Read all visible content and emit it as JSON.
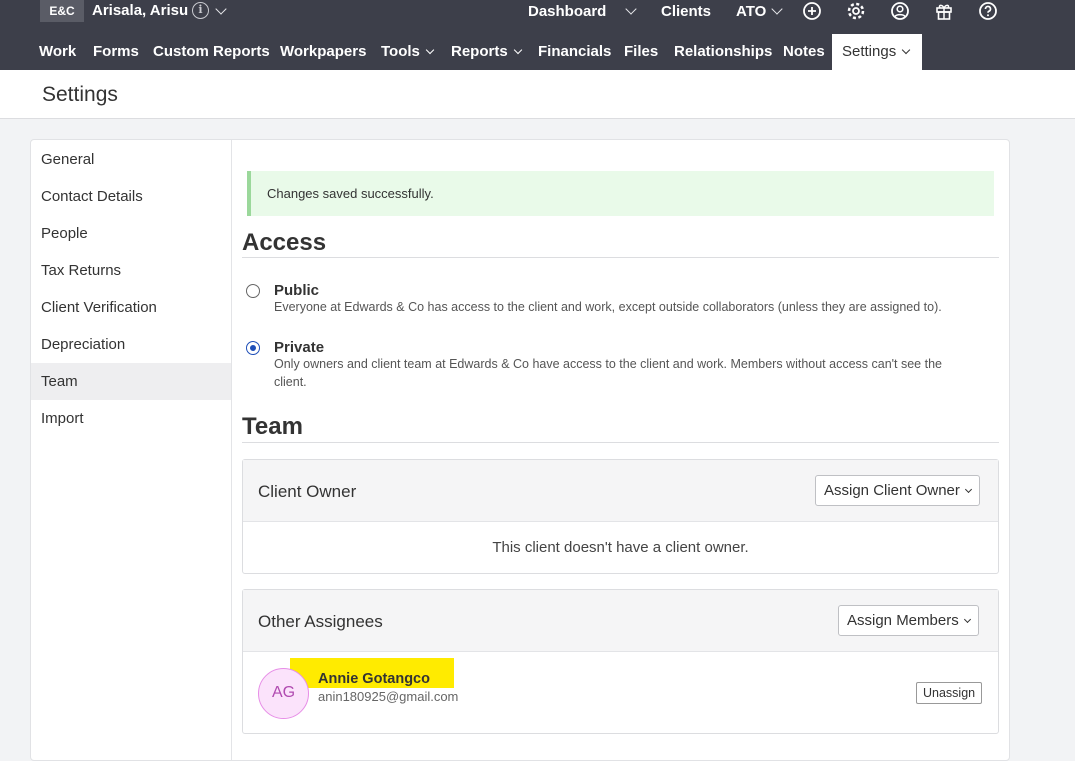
{
  "topbar": {
    "logo": "E&C",
    "client_name": "Arisala, Arisu",
    "links": {
      "dashboard": "Dashboard",
      "clients": "Clients",
      "ato": "ATO"
    }
  },
  "nav": {
    "items": [
      "Work",
      "Forms",
      "Custom Reports",
      "Workpapers",
      "Tools",
      "Reports",
      "Financials",
      "Files",
      "Relationships",
      "Notes",
      "Settings"
    ]
  },
  "page": {
    "title": "Settings"
  },
  "sidebar": {
    "items": [
      "General",
      "Contact Details",
      "People",
      "Tax Returns",
      "Client Verification",
      "Depreciation",
      "Team",
      "Import"
    ],
    "active": "Team"
  },
  "alert": {
    "message": "Changes saved successfully."
  },
  "access": {
    "heading": "Access",
    "options": [
      {
        "title": "Public",
        "description": "Everyone at Edwards & Co has access to the client and work, except outside collaborators (unless they are assigned to).",
        "selected": false
      },
      {
        "title": "Private",
        "description": "Only owners and client team at Edwards & Co have access to the client and work. Members without access can't see the client.",
        "selected": true
      }
    ]
  },
  "team": {
    "heading": "Team",
    "client_owner": {
      "title": "Client Owner",
      "button": "Assign Client Owner",
      "empty_message": "This client doesn't have a client owner."
    },
    "other_assignees": {
      "title": "Other Assignees",
      "button": "Assign Members",
      "members": [
        {
          "initials": "AG",
          "name": "Annie Gotangco",
          "email": "anin180925@gmail.com",
          "action": "Unassign"
        }
      ]
    }
  },
  "colors": {
    "topbar": "#3d3f4a",
    "alert_bg": "#e9fae9",
    "alert_border": "#9bd89b",
    "radio_accent": "#1f4fb8",
    "highlight": "#ffeb00",
    "avatar_bg": "#fbe3fb"
  }
}
